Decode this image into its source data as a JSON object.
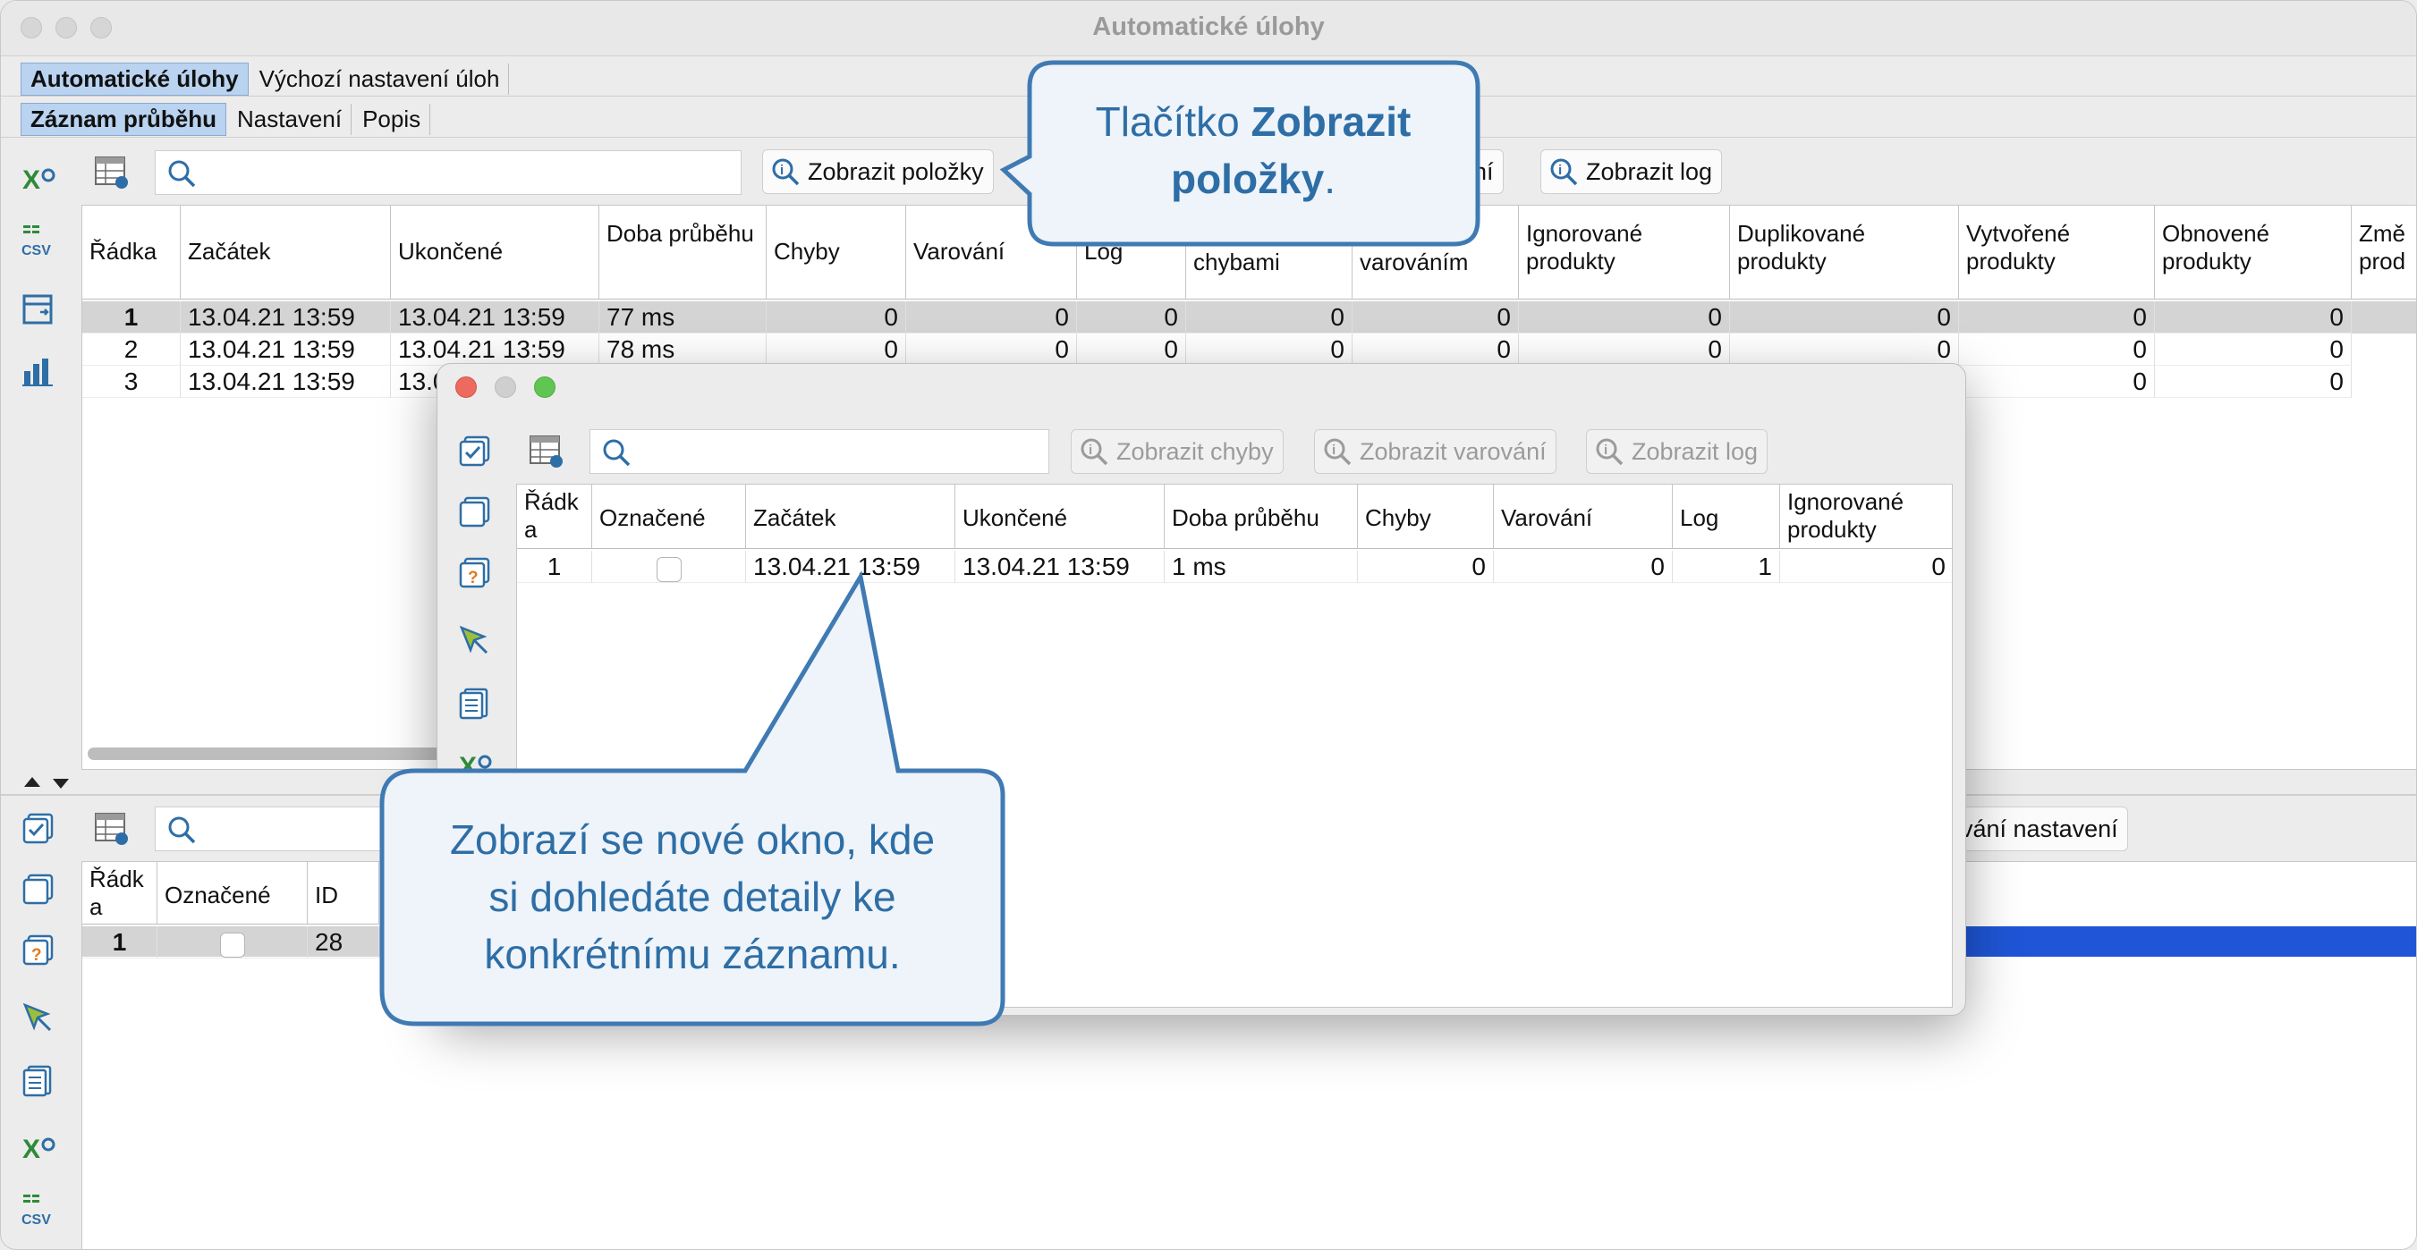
{
  "window": {
    "title": "Automatické úlohy"
  },
  "colors": {
    "accent": "#2e6ea6",
    "tab_active": "#b9d3f0",
    "selection": "#1f55d6",
    "close": "#ed6a5e",
    "minimize": "#f5bf4f",
    "zoom": "#61c554"
  },
  "top_tabs": [
    "Automatické úlohy",
    "Výchozí nastavení úloh"
  ],
  "sub_tabs": [
    "Záznam průběhu",
    "Nastavení",
    "Popis"
  ],
  "main_toolbar": {
    "search_placeholder": "",
    "btn_items": "Zobrazit položky",
    "btn_warnings_partial": "ání",
    "btn_log": "Zobrazit log"
  },
  "main_table": {
    "headers": [
      "Řádka",
      "Začátek",
      "Ukončené",
      "Doba průběhu",
      "Chyby",
      "Varování",
      "Log",
      "chybami",
      "varováním",
      "Ignorované produkty",
      "Duplikované produkty",
      "Vytvořené produkty",
      "Obnovené produkty",
      "Změ prod"
    ],
    "rows": [
      [
        "1",
        "13.04.21 13:59",
        "13.04.21 13:59",
        "77 ms",
        "0",
        "0",
        "0",
        "0",
        "0",
        "0",
        "0",
        "0",
        "0"
      ],
      [
        "2",
        "13.04.21 13:59",
        "13.04.21 13:59",
        "78 ms",
        "0",
        "0",
        "0",
        "0",
        "0",
        "0",
        "0",
        "0",
        "0"
      ],
      [
        "3",
        "13.04.21 13:59",
        "13.0",
        "",
        "",
        "",
        "",
        "",
        "",
        "",
        "",
        "0",
        "0"
      ]
    ]
  },
  "bottom_panel": {
    "btn_partial": "vání nastavení",
    "headers": [
      "Řádk a",
      "Označené",
      "ID"
    ],
    "rows": [
      [
        "1",
        "",
        "28"
      ]
    ]
  },
  "dialog": {
    "btn_errors": "Zobrazit chyby",
    "btn_warnings": "Zobrazit varování",
    "btn_log": "Zobrazit log",
    "headers": [
      "Řádk a",
      "Označené",
      "Začátek",
      "Ukončené",
      "Doba průběhu",
      "Chyby",
      "Varování",
      "Log",
      "Ignorované produkty"
    ],
    "rows": [
      [
        "1",
        "",
        "13.04.21 13:59",
        "13.04.21 13:59",
        "1 ms",
        "0",
        "0",
        "1",
        "0"
      ]
    ]
  },
  "callouts": {
    "top_prefix": "Tlačítko ",
    "top_bold_1": "Zobrazit",
    "top_bold_2": "položky",
    "top_suffix": ".",
    "bottom_line_1": "Zobrazí se nové okno, kde",
    "bottom_line_2": "si dohledáte detaily ke",
    "bottom_line_3": "konkrétnímu záznamu."
  }
}
